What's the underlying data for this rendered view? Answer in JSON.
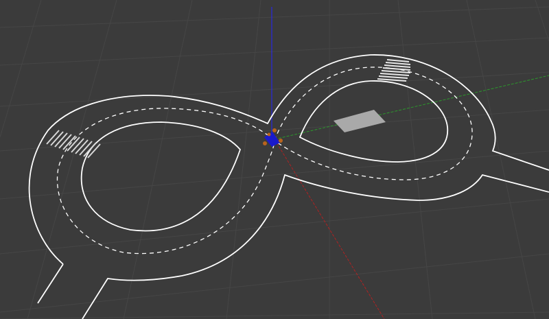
{
  "scene": {
    "background_color": "#3b3b3b",
    "grid_color": "#4a4a4a",
    "track_line_color": "#ffffff",
    "stop_pad_color": "#a9a9a9",
    "axes": {
      "x_color": "#b02222",
      "y_color": "#2c9a2c",
      "z_color": "#2a2ae0"
    },
    "robot": {
      "body_color": "#1a1acc",
      "wheel_color": "#b8641e"
    }
  }
}
